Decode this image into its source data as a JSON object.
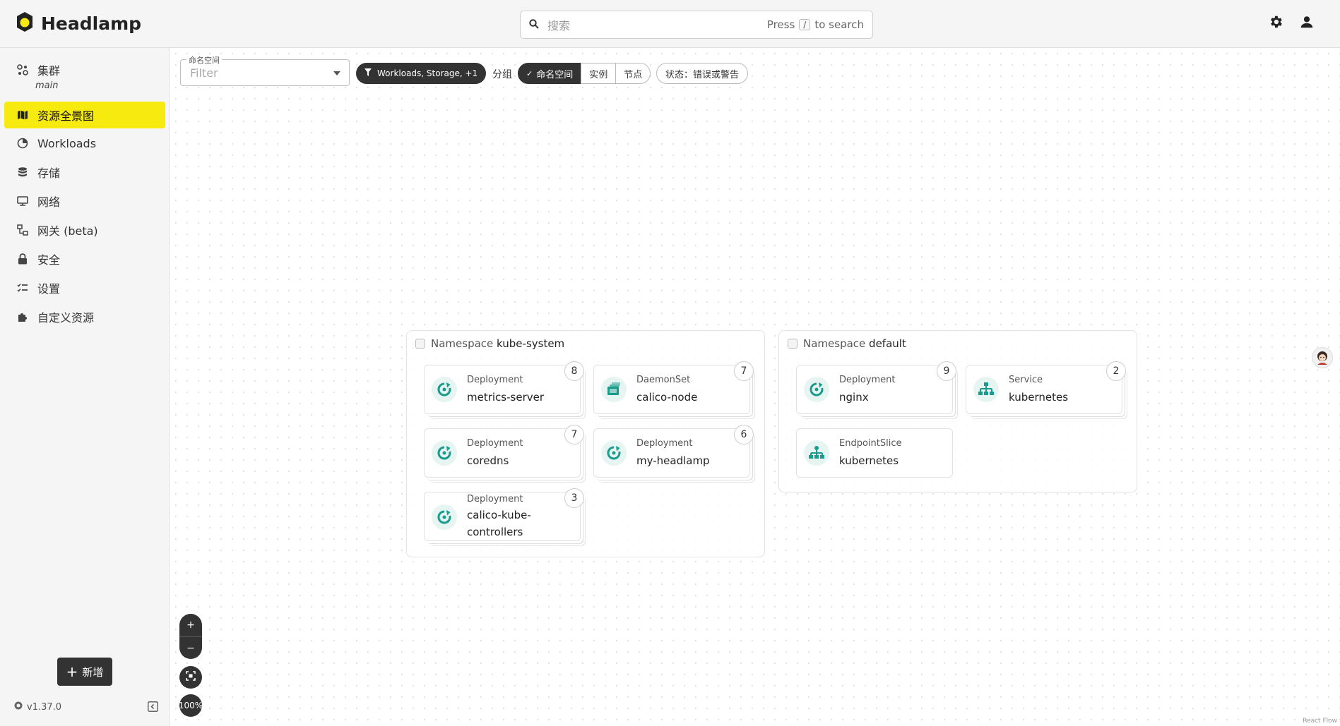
{
  "header": {
    "app_title": "Headlamp",
    "search_placeholder": "搜索",
    "search_hint_press": "Press",
    "search_hint_key": "/",
    "search_hint_suffix": "to search"
  },
  "sidebar": {
    "cluster_label": "集群",
    "cluster_name": "main",
    "items": [
      {
        "label": "资源全景图",
        "icon": "map-icon",
        "active": true
      },
      {
        "label": "Workloads",
        "icon": "workloads-icon"
      },
      {
        "label": "存储",
        "icon": "storage-icon"
      },
      {
        "label": "网络",
        "icon": "network-icon"
      },
      {
        "label": "网关 (beta)",
        "icon": "gateway-icon"
      },
      {
        "label": "安全",
        "icon": "lock-icon"
      },
      {
        "label": "设置",
        "icon": "settings-list-icon"
      },
      {
        "label": "自定义资源",
        "icon": "puzzle-icon"
      }
    ],
    "add_button": "新增",
    "version": "v1.37.0"
  },
  "toolbar": {
    "namespace_label": "命名空间",
    "namespace_placeholder": "Filter",
    "filter_chip": "Workloads, Storage, +1",
    "group_label": "分组",
    "group_options": [
      "命名空间",
      "实例",
      "节点"
    ],
    "group_selected": "命名空间",
    "status_chip": "状态：错误或警告"
  },
  "namespaces": [
    {
      "prefix": "Namespace",
      "name": "kube-system",
      "cards": [
        {
          "kind": "Deployment",
          "name": "metrics-server",
          "count": "8",
          "icon": "deployment-icon"
        },
        {
          "kind": "DaemonSet",
          "name": "calico-node",
          "count": "7",
          "icon": "daemonset-icon"
        },
        {
          "kind": "Deployment",
          "name": "coredns",
          "count": "7",
          "icon": "deployment-icon"
        },
        {
          "kind": "Deployment",
          "name": "my-headlamp",
          "count": "6",
          "icon": "deployment-icon"
        },
        {
          "kind": "Deployment",
          "name": "calico-kube-controllers",
          "count": "3",
          "icon": "deployment-icon"
        }
      ]
    },
    {
      "prefix": "Namespace",
      "name": "default",
      "cards": [
        {
          "kind": "Deployment",
          "name": "nginx",
          "count": "9",
          "icon": "deployment-icon"
        },
        {
          "kind": "Service",
          "name": "kubernetes",
          "count": "2",
          "icon": "service-icon"
        },
        {
          "kind": "EndpointSlice",
          "name": "kubernetes",
          "count": "",
          "icon": "endpointslice-icon"
        }
      ]
    }
  ],
  "zoom": {
    "plus": "+",
    "minus": "−",
    "level": "100%"
  },
  "attribution": "React Flow",
  "colors": {
    "accent": "#f7ea0f",
    "dark": "#333333",
    "teal": "#1a9c8c"
  }
}
